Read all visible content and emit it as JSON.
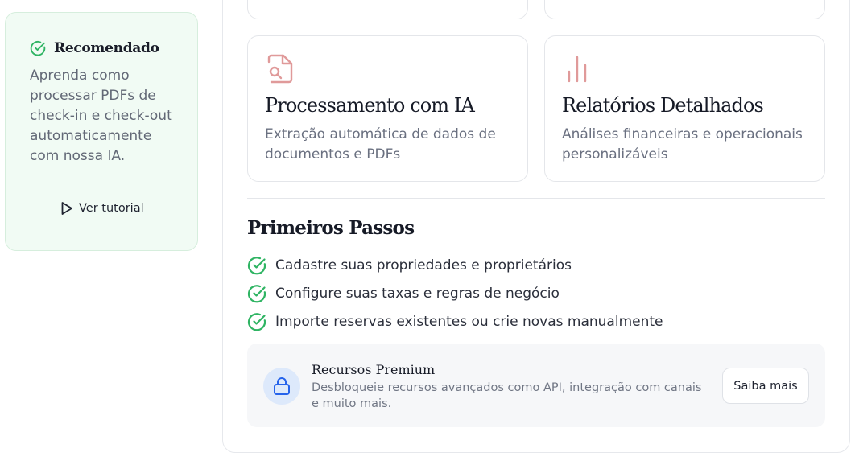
{
  "recommended": {
    "title": "Recomendado",
    "description": "Aprenda como processar PDFs de check-in e check-out automaticamente com nossa IA.",
    "tutorial_label": "Ver tutorial",
    "icon": "check-circle-icon",
    "accent": "#2fb463"
  },
  "features": [
    {
      "title": "Processamento com IA",
      "description": "Extração automática de dados de documentos e PDFs",
      "icon": "file-search-icon"
    },
    {
      "title": "Relatórios Detalhados",
      "description": "Análises financeiras e operacionais personalizáveis",
      "icon": "bar-chart-icon"
    }
  ],
  "feature_icon_color": "#e09a9a",
  "getting_started": {
    "title": "Primeiros Passos",
    "steps": [
      "Cadastre suas propriedades e proprietários",
      "Configure suas taxas e regras de negócio",
      "Importe reservas existentes ou crie novas manualmente"
    ]
  },
  "premium": {
    "title": "Recursos Premium",
    "description": "Desbloqueie recursos avançados como API, integração com canais e muito mais.",
    "button_label": "Saiba mais",
    "icon": "lock-icon",
    "accent": "#2563eb"
  }
}
